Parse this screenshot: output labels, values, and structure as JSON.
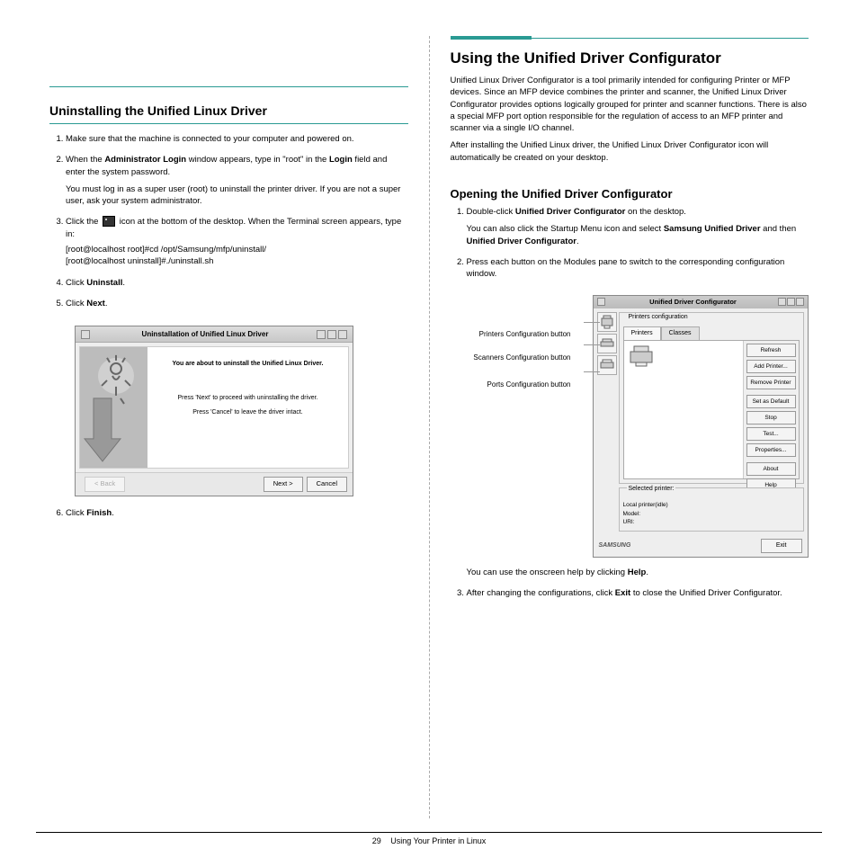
{
  "left": {
    "section_title": "Uninstalling the Unified Linux Driver",
    "steps": [
      {
        "text_a": "Make sure that the machine is connected to your computer and powered on."
      },
      {
        "text_a": "When the ",
        "bold1": "Administrator Login",
        "text_b": " window appears, type in \"root\" in the ",
        "bold2": "Login",
        "text_c": " field and enter the system password."
      },
      {
        "note": "You must log in as a super user (root) to uninstall the printer driver. If you are not a super user, ask your system administrator."
      },
      {
        "text_a": "Click the ",
        "bold1": null,
        "text_b": " icon at the bottom of the desktop. When the Terminal screen appears, type in:",
        "code": "[root@localhost root]#cd /opt/Samsung/mfp/uninstall/\n[root@localhost uninstall]#./uninstall.sh"
      },
      {
        "text_a": "Click ",
        "bold1": "Uninstall",
        "text_b": "."
      },
      {
        "text_a": "Click ",
        "bold1": "Next",
        "text_b": "."
      }
    ],
    "dialog": {
      "title": "Uninstallation of Unified Linux Driver",
      "line1": "You are about to uninstall the Unified Linux Driver.",
      "line2": "Press 'Next' to proceed with uninstalling the driver.",
      "line3": "Press 'Cancel' to leave the driver intact.",
      "btn_back": "< Back",
      "btn_next": "Next >",
      "btn_cancel": "Cancel"
    },
    "step6": {
      "text_a": "Click ",
      "bold1": "Finish",
      "text_b": "."
    }
  },
  "right": {
    "title": "Using the Unified Driver Configurator",
    "intro1": "Unified Linux Driver Configurator is a tool primarily intended for configuring Printer or MFP devices. Since an MFP device combines the printer and scanner, the Unified Linux Driver Configurator provides options logically grouped for printer and scanner functions. There is also a special MFP port option responsible for the regulation of access to an MFP printer and scanner via a single I/O channel.",
    "intro2": "After installing the Unified Linux driver, the Unified Linux Driver Configurator icon will automatically be created on your desktop.",
    "sub_title": "Opening the Unified Driver Configurator",
    "step1": "Double-click Unified Driver Configurator on the desktop.",
    "step1b": "You can also click the Startup Menu icon and select Samsung Unified Driver and then Unified Driver Configurator.",
    "step2": "Press each button on the Modules pane to switch to the corresponding configuration window.",
    "labels": {
      "printers": "Printers Configuration button",
      "scanners": "Scanners Configuration button",
      "ports": "Ports Configuration button"
    },
    "config": {
      "title": "Unified Driver Configurator",
      "group_title": "Printers configuration",
      "tab_printers": "Printers",
      "tab_classes": "Classes",
      "buttons": {
        "refresh": "Refresh",
        "add": "Add Printer...",
        "remove": "Remove Printer",
        "setdefault": "Set as Default",
        "stop": "Stop",
        "test": "Test...",
        "properties": "Properties...",
        "about": "About",
        "help": "Help"
      },
      "selected_title": "Selected printer:",
      "selected_lines": "Local printer(idle)\nModel:\nURI:",
      "logo": "SAMSUNG",
      "exit": "Exit"
    },
    "hint": "You can use the onscreen help by clicking Help.",
    "step3": "After changing the configurations, click Exit to close the Unified Driver Configurator."
  },
  "footer": {
    "page": "29",
    "text": "Using Your Printer in Linux"
  }
}
